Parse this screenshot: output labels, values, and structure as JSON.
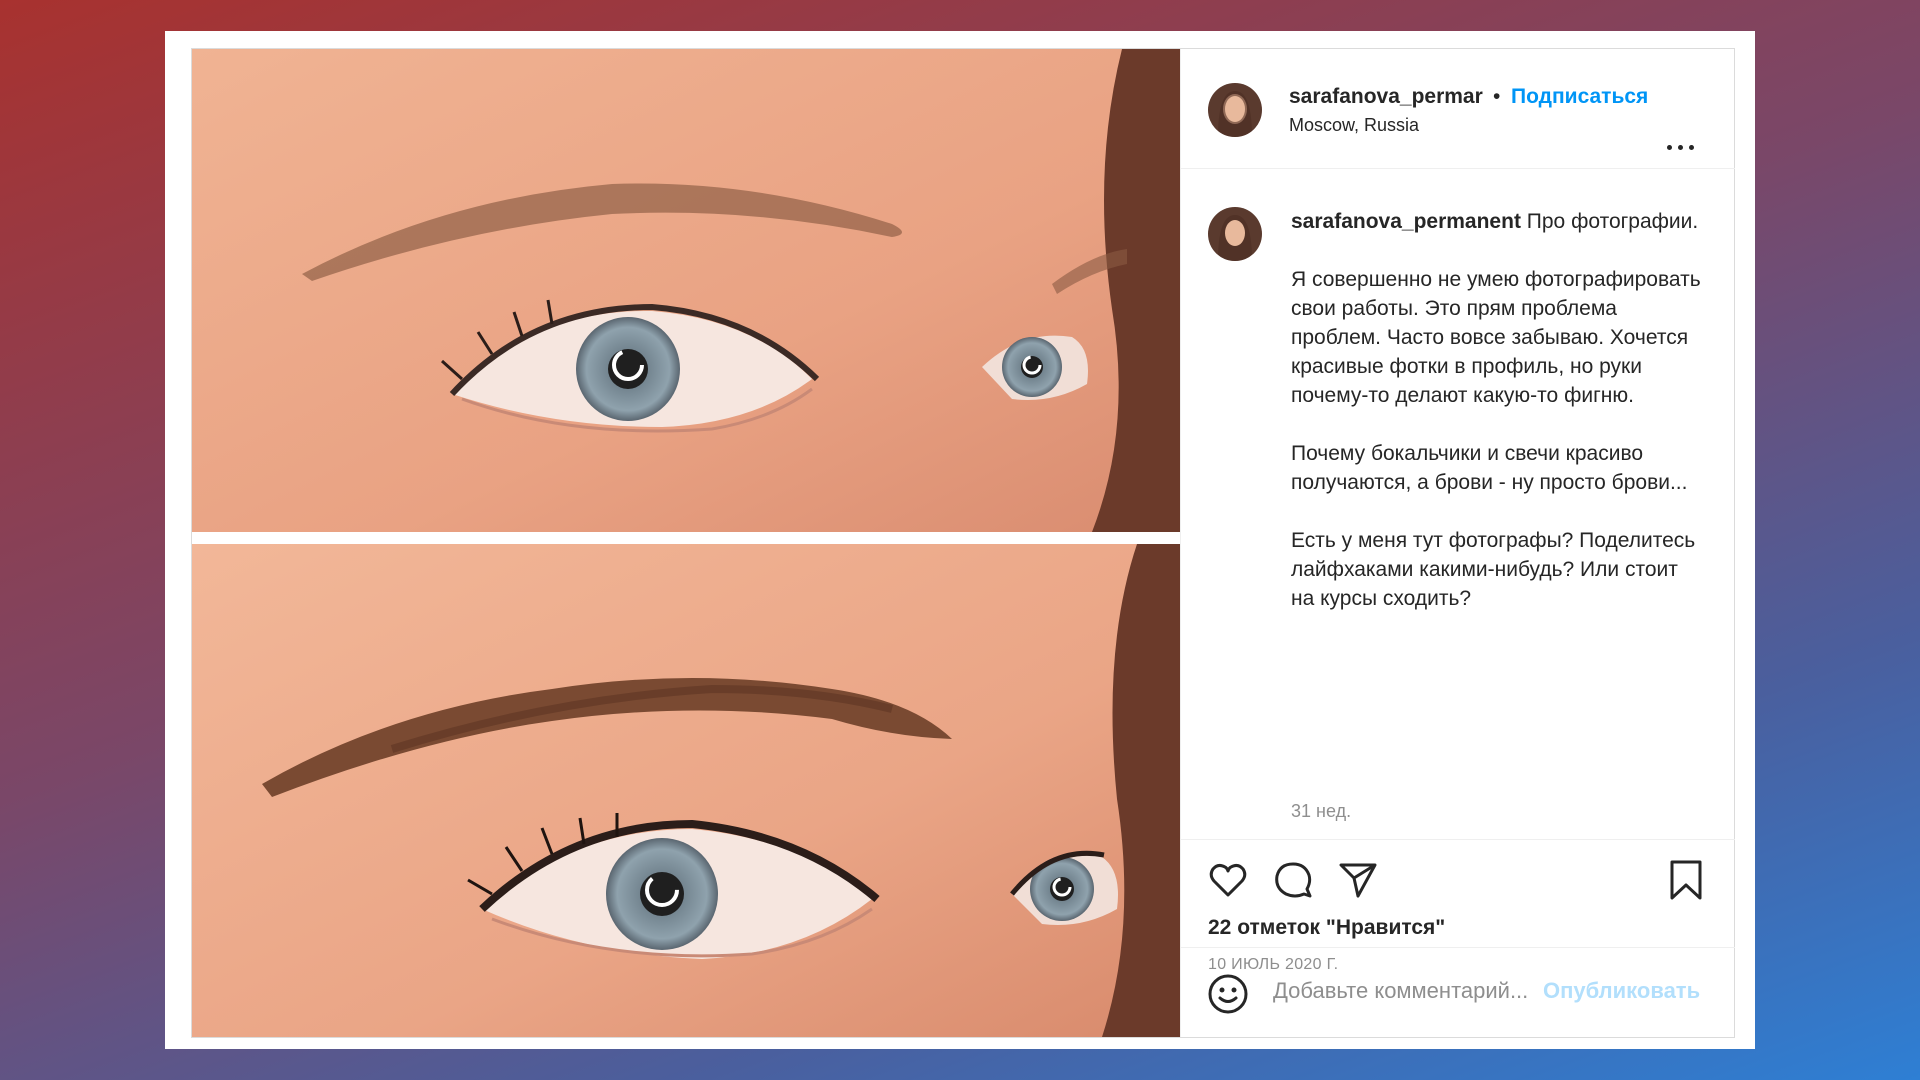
{
  "header": {
    "username": "sarafanova_permar",
    "separator": "•",
    "follow_label": "Подписаться",
    "location": "Moscow, Russia",
    "more_icon": "more-horizontal-icon"
  },
  "caption": {
    "username": "sarafanova_permanent",
    "intro": "Про фотографии.",
    "paragraphs": [
      "Я совершенно не умею фотографировать свои работы. Это прям проблема проблем. Часто вовсе забываю. Хочется красивые фотки в профиль, но руки почему-то делают какую-то фигню.",
      "Почему бокальчики и свечи красиво получаются, а брови - ну просто брови...",
      "Есть у меня тут фотографы? Поделитесь лайфхаками какими-нибудь? Или стоит на курсы сходить?"
    ],
    "age": "31 нед."
  },
  "actions": {
    "icons": [
      "heart-icon",
      "comment-icon",
      "share-icon",
      "bookmark-icon"
    ],
    "likes": "22 отметок \"Нравится\"",
    "date": "10 ИЮЛЬ 2020 Г."
  },
  "comment": {
    "placeholder": "Добавьте комментарий...",
    "publish_label": "Опубликовать",
    "emoji_icon": "smiley-icon"
  },
  "colors": {
    "link_blue": "#0095f6",
    "publish_disabled": "#b2dffc",
    "text": "#262626",
    "muted": "#8e8e8e"
  }
}
